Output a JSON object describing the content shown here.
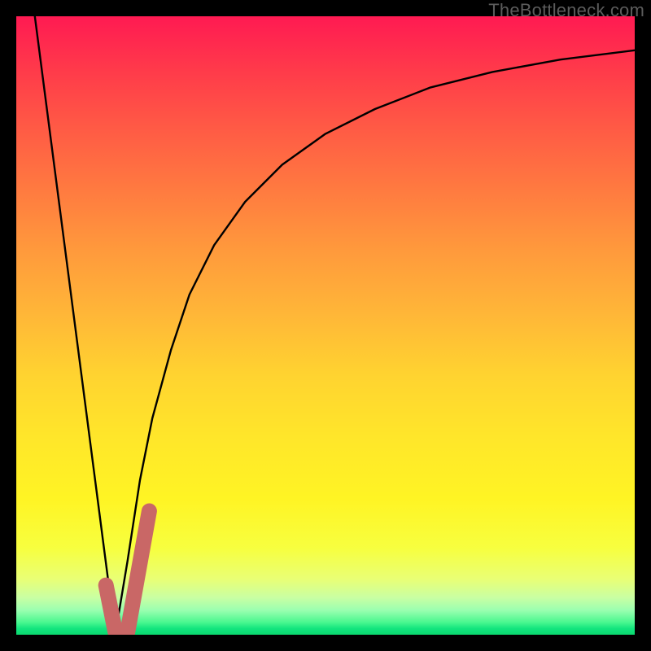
{
  "watermark": {
    "text": "TheBottleneck.com"
  },
  "colors": {
    "frame": "#000000",
    "curve": "#000000",
    "highlight": "#c96766",
    "gradient_top": "#ff1a52",
    "gradient_bottom": "#0bd96f"
  },
  "chart_data": {
    "type": "line",
    "title": "",
    "xlabel": "",
    "ylabel": "",
    "xlim": [
      0,
      100
    ],
    "ylim": [
      0,
      100
    ],
    "grid": false,
    "legend": false,
    "series": [
      {
        "name": "left-descent",
        "x": [
          3,
          16
        ],
        "y": [
          100,
          0
        ]
      },
      {
        "name": "right-rise",
        "x": [
          16,
          18,
          20,
          22,
          25,
          28,
          32,
          37,
          43,
          50,
          58,
          67,
          77,
          88,
          100
        ],
        "y": [
          0,
          12,
          25,
          35,
          46,
          55,
          63,
          70,
          76,
          81,
          85,
          88.5,
          91,
          93,
          94.5
        ]
      }
    ],
    "highlight_segment": {
      "name": "check-mark",
      "points": [
        {
          "x": 14.5,
          "y": 8
        },
        {
          "x": 16.0,
          "y": 0.5
        },
        {
          "x": 18.0,
          "y": 0.5
        },
        {
          "x": 21.5,
          "y": 20
        }
      ]
    }
  }
}
